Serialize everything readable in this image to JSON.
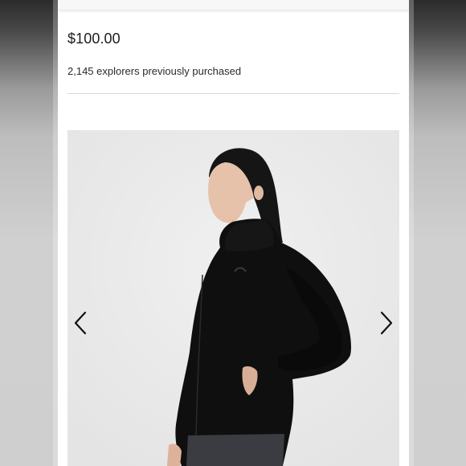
{
  "product": {
    "price": "$100.00",
    "purchase_count_text": "2,145 explorers previously purchased"
  },
  "gallery": {
    "image_subject": "black-fleece-jacket-on-model",
    "prev_icon": "chevron-left-icon",
    "next_icon": "chevron-right-icon"
  },
  "colors": {
    "background": "#ffffff",
    "gallery_background": "#e9e9e9",
    "text": "#1c1c1c",
    "divider": "#d6d6d6"
  }
}
